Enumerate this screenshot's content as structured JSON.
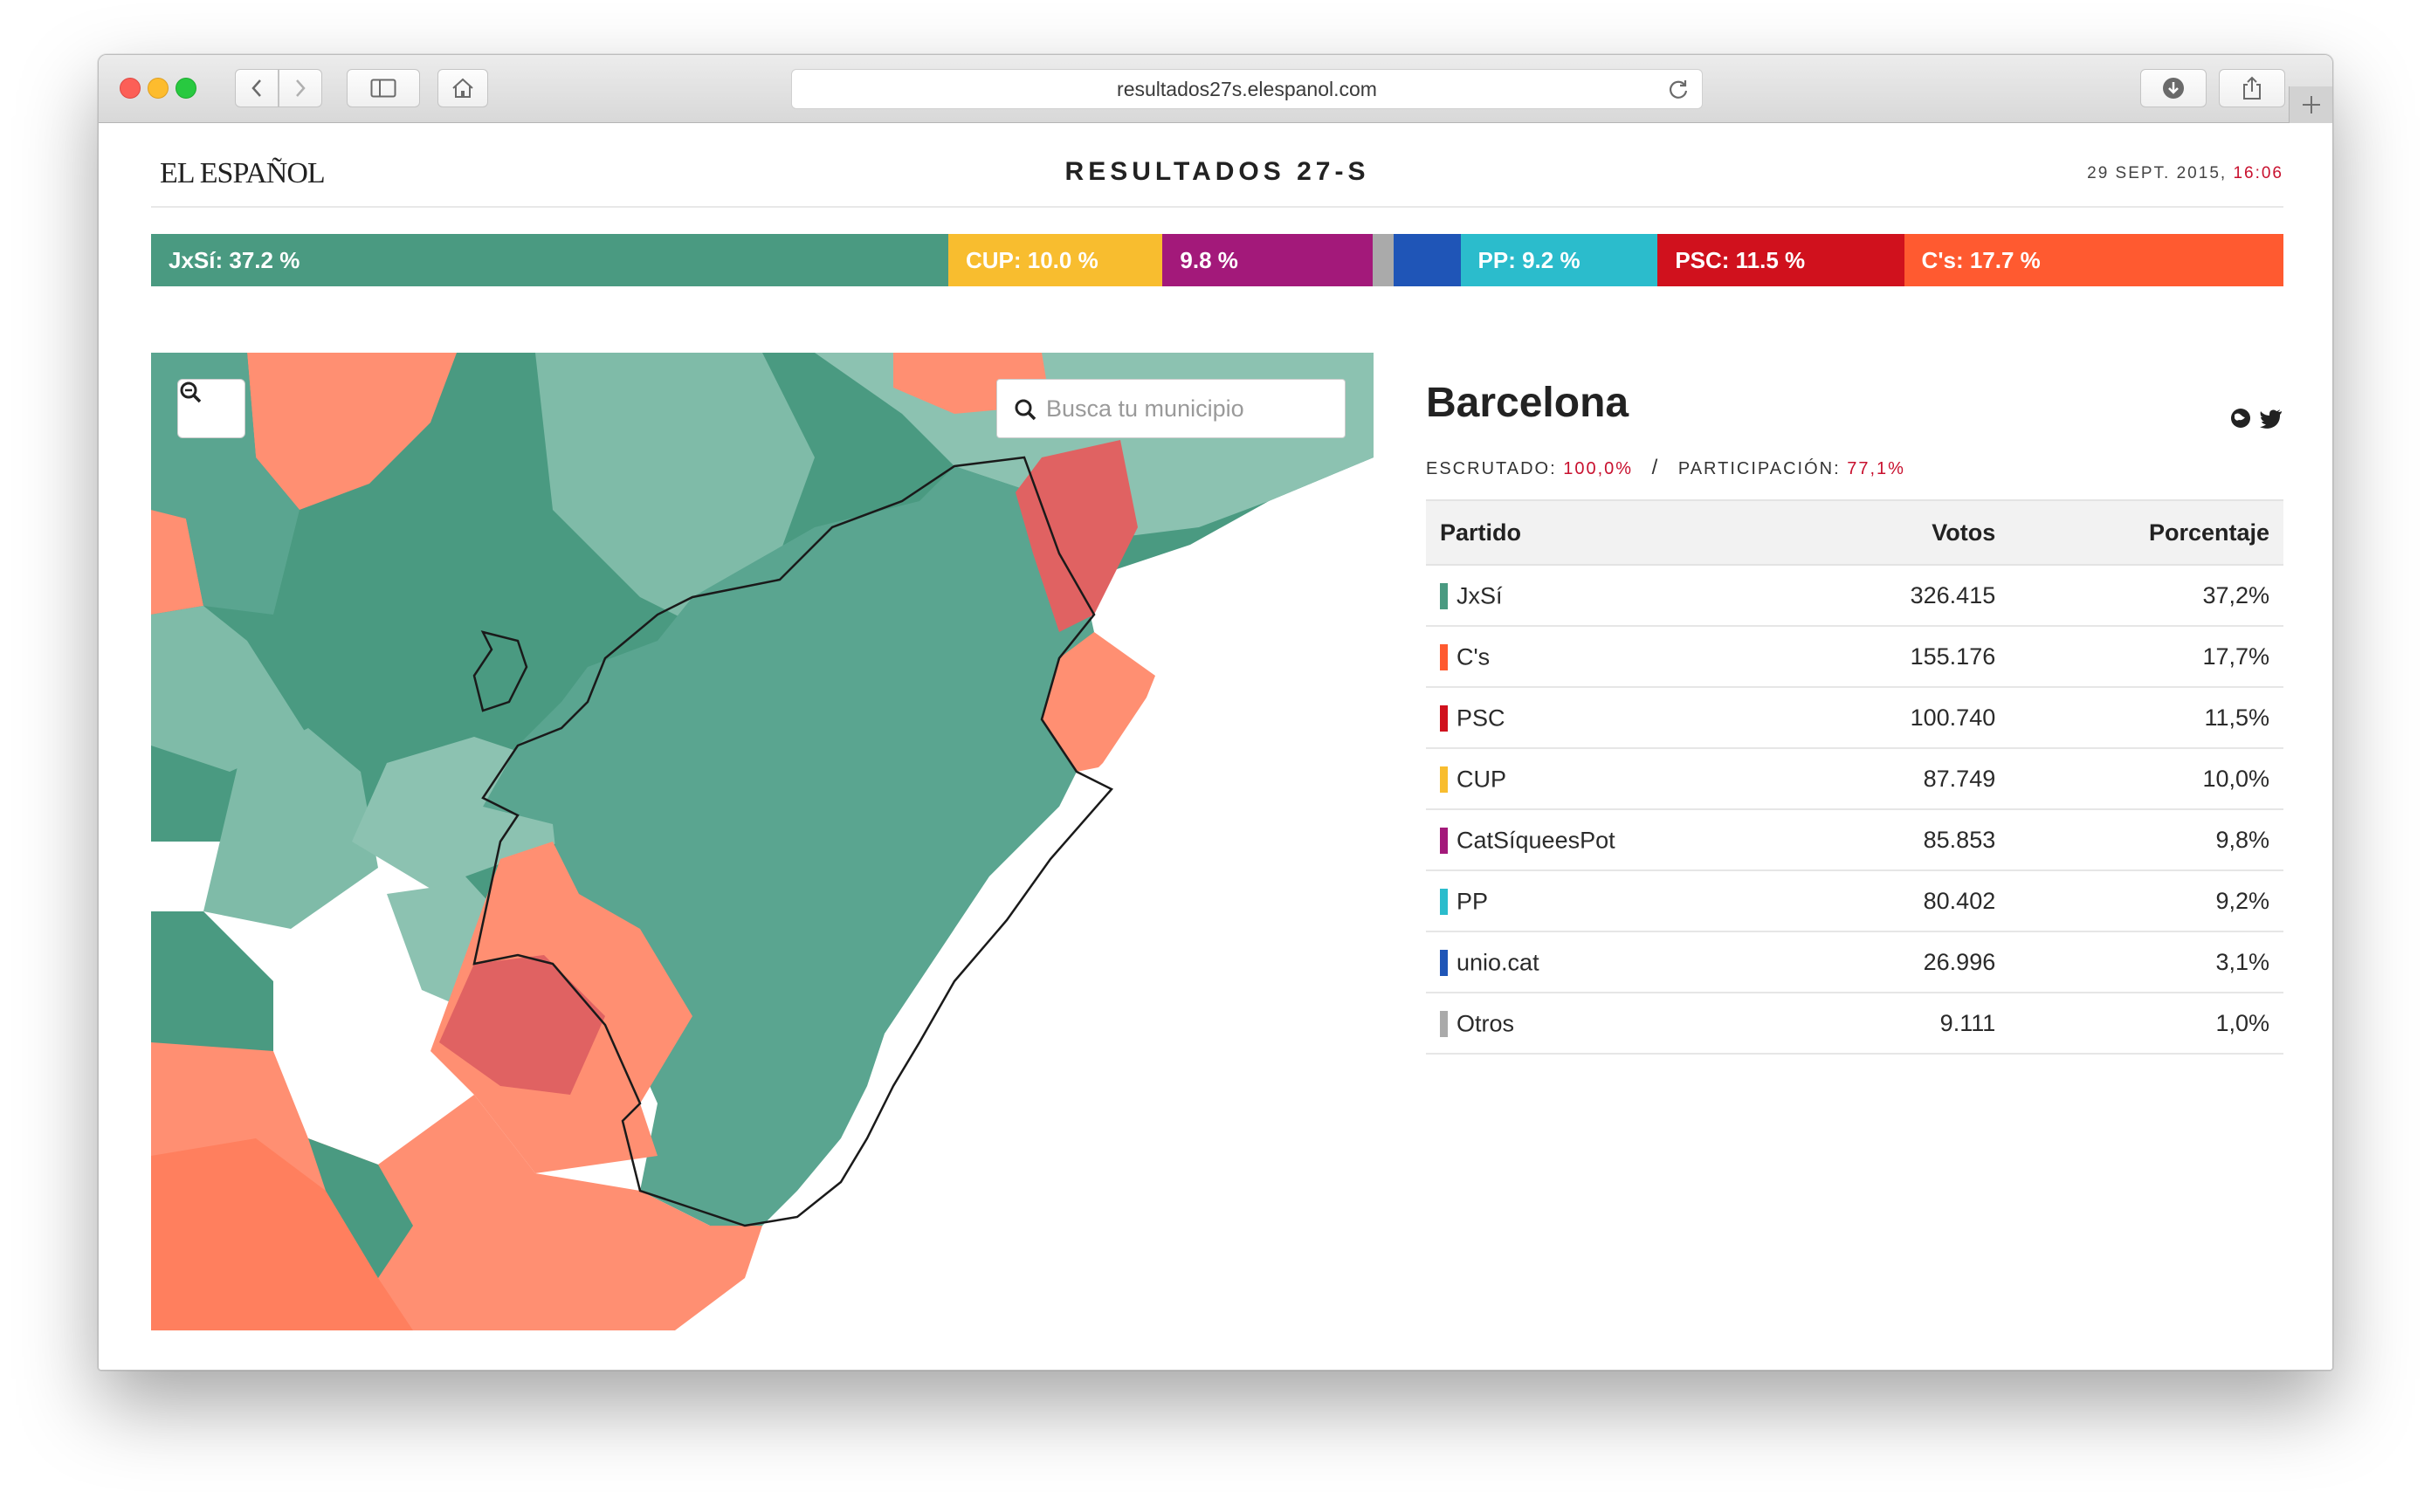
{
  "browser": {
    "url": "resultados27s.elespanol.com"
  },
  "header": {
    "logo": "EL ESPAÑOL",
    "title": "RESULTADOS 27-S",
    "date": "29 SEPT. 2015,",
    "time": "16:06"
  },
  "summary_bar": [
    {
      "label": "JxSí: 37.2 %",
      "share": 37.2,
      "color": "#4a9a81"
    },
    {
      "label": "CUP: 10.0 %",
      "share": 10.0,
      "color": "#f8bd2f"
    },
    {
      "label": "9.8 %",
      "share": 9.8,
      "color": "#a3197a"
    },
    {
      "label": "",
      "share": 1.0,
      "color": "#aaaaaa"
    },
    {
      "label": "",
      "share": 3.1,
      "color": "#1f55b7"
    },
    {
      "label": "PP: 9.2 %",
      "share": 9.2,
      "color": "#2bbccc"
    },
    {
      "label": "PSC: 11.5 %",
      "share": 11.5,
      "color": "#d0111d"
    },
    {
      "label": "C's: 17.7 %",
      "share": 17.7,
      "color": "#ff5a30"
    }
  ],
  "map": {
    "search_placeholder": "Busca tu municipio",
    "zoom_icon": "zoom-out-icon",
    "search_icon": "search-icon"
  },
  "panel": {
    "city": "Barcelona",
    "escrutado_label": "ESCRUTADO:",
    "escrutado_value": "100,0%",
    "separator": "/",
    "participacion_label": "PARTICIPACIÓN:",
    "participacion_value": "77,1%",
    "columns": [
      "Partido",
      "Votos",
      "Porcentaje"
    ],
    "rows": [
      {
        "party": "JxSí",
        "votes": "326.415",
        "pct": "37,2%",
        "color": "#4a9a81"
      },
      {
        "party": "C's",
        "votes": "155.176",
        "pct": "17,7%",
        "color": "#ff5a30"
      },
      {
        "party": "PSC",
        "votes": "100.740",
        "pct": "11,5%",
        "color": "#d0111d"
      },
      {
        "party": "CUP",
        "votes": "87.749",
        "pct": "10,0%",
        "color": "#f8bd2f"
      },
      {
        "party": "CatSíqueesPot",
        "votes": "85.853",
        "pct": "9,8%",
        "color": "#a3197a"
      },
      {
        "party": "PP",
        "votes": "80.402",
        "pct": "9,2%",
        "color": "#2bbccc"
      },
      {
        "party": "unio.cat",
        "votes": "26.996",
        "pct": "3,1%",
        "color": "#1f55b7"
      },
      {
        "party": "Otros",
        "votes": "9.111",
        "pct": "1,0%",
        "color": "#aaaaaa"
      }
    ]
  }
}
